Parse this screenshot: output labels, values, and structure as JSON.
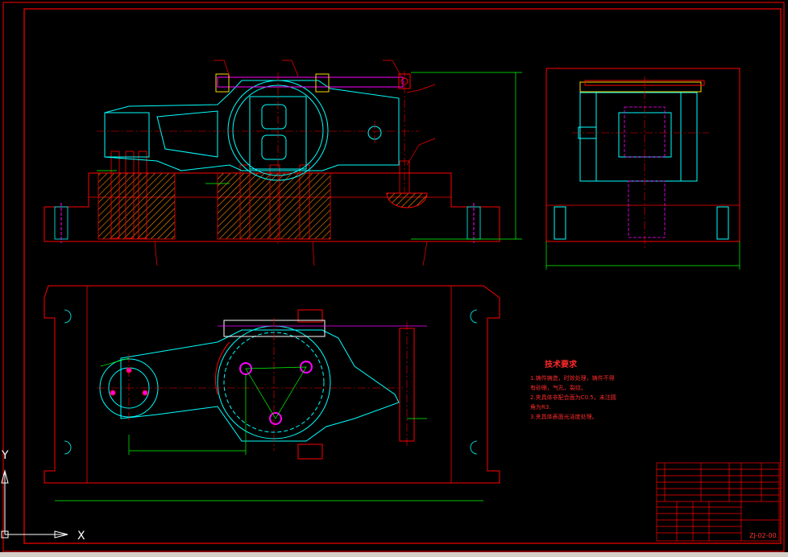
{
  "drawing": {
    "tech_title": "技术要求",
    "tech_lines": [
      "1.铸件铸造，时效处理，铸件不得",
      "有砂眼，气孔，裂纹。",
      "2.夹具体非配合面为C0.5，未注圆",
      "角为R3.",
      "3.夹具体表面光洁度处理。"
    ],
    "title_block": {
      "drawing_number": "ZJ-02-00"
    }
  },
  "ucs": {
    "x_label": "X",
    "y_label": "Y"
  },
  "colors": {
    "background": "#000000",
    "border": "#ff0000",
    "outline_cyan": "#00ffff",
    "dimension_green": "#00ff00",
    "hidden_magenta": "#ff00ff",
    "hatch_orange": "#ff8c00",
    "center_red": "#ff0000"
  }
}
